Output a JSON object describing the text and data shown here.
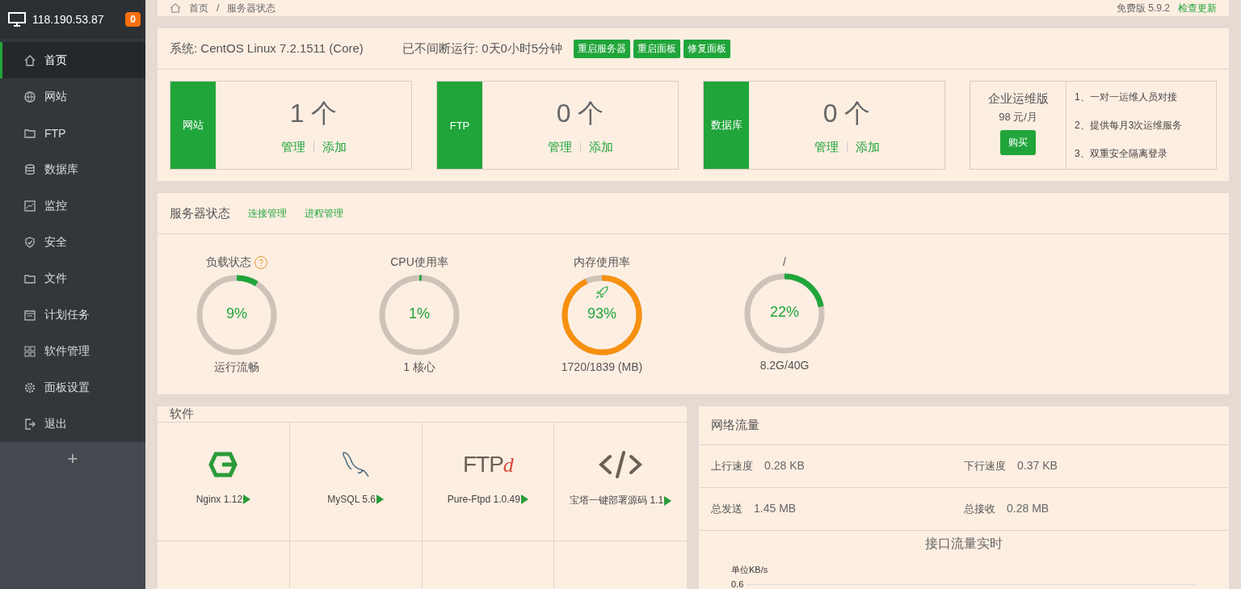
{
  "sidebar": {
    "host": "118.190.53.87",
    "badge": "0",
    "items": [
      {
        "label": "首页",
        "selected": true
      },
      {
        "label": "网站",
        "selected": false
      },
      {
        "label": "FTP",
        "selected": false
      },
      {
        "label": "数据库",
        "selected": false
      },
      {
        "label": "监控",
        "selected": false
      },
      {
        "label": "安全",
        "selected": false
      },
      {
        "label": "文件",
        "selected": false
      },
      {
        "label": "计划任务",
        "selected": false
      },
      {
        "label": "软件管理",
        "selected": false
      },
      {
        "label": "面板设置",
        "selected": false
      },
      {
        "label": "退出",
        "selected": false
      }
    ],
    "add": "+"
  },
  "breadcrumb": {
    "items": [
      "首页",
      "服务器状态"
    ],
    "separator": "/",
    "version": "免费版 5.9.2",
    "update_link": "检查更新"
  },
  "overview": {
    "system": "系统: CentOS Linux 7.2.1511 (Core)",
    "uptime": "已不间断运行: 0天0小时5分钟",
    "actions": [
      "重启服务器",
      "重启面板",
      "修复面板"
    ],
    "stats": [
      {
        "label": "网站",
        "count": "1 个",
        "manage": "管理",
        "add": "添加"
      },
      {
        "label": "FTP",
        "count": "0 个",
        "manage": "管理",
        "add": "添加"
      },
      {
        "label": "数据库",
        "count": "0 个",
        "manage": "管理",
        "add": "添加"
      }
    ],
    "promo": {
      "title": "企业运维版",
      "price": "98 元/月",
      "buy": "购买",
      "features": [
        "1、一对一运维人员对接",
        "2、提供每月3次运维服务",
        "3、双重安全隔离登录"
      ]
    }
  },
  "server_status": {
    "title": "服务器状态",
    "links": [
      "连接管理",
      "进程管理"
    ],
    "gauges": [
      {
        "title": "负载状态",
        "help": "?",
        "boost": false,
        "value": "9%",
        "sub": "运行流畅",
        "level": 0.09,
        "color": "#20a53a"
      },
      {
        "title": "CPU使用率",
        "boost": false,
        "value": "1%",
        "sub": "1 核心",
        "level": 0.01,
        "color": "#20a53a"
      },
      {
        "title": "内存使用率",
        "boost": true,
        "value": "93%",
        "sub": "1720/1839 (MB)",
        "level": 0.93,
        "color": "#f7900e"
      },
      {
        "title": "/",
        "boost": false,
        "value": "22%",
        "sub": "8.2G/40G",
        "level": 0.22,
        "color": "#20a53a"
      }
    ]
  },
  "software": {
    "title": "软件",
    "items": [
      {
        "kind": "nginx",
        "name": "Nginx 1.12"
      },
      {
        "kind": "mysql",
        "name": "MySQL 5.6"
      },
      {
        "kind": "ftpd",
        "name": "Pure-Ftpd 1.0.49",
        "logo": "FTP",
        "logo_suffix": "d"
      },
      {
        "kind": "code",
        "name": "宝塔一键部署源码 1.1"
      }
    ]
  },
  "network": {
    "title": "网络流量",
    "stats": [
      {
        "label": "上行速度",
        "value": "0.28 KB"
      },
      {
        "label": "下行速度",
        "value": "0.37 KB"
      },
      {
        "label": "总发送",
        "value": "1.45 MB"
      },
      {
        "label": "总接收",
        "value": "0.28 MB"
      }
    ],
    "chart_title": "接口流量实时",
    "unit": "单位KB/s",
    "tick": "0.6"
  }
}
